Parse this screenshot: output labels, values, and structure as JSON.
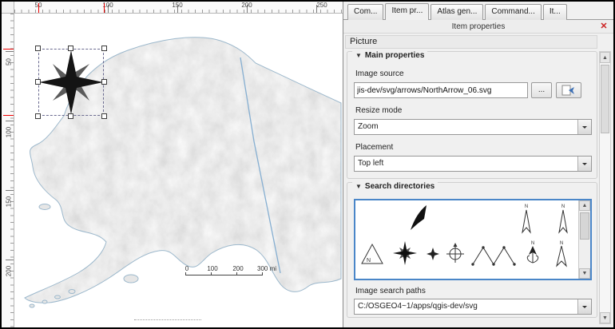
{
  "rulers": {
    "top": [
      "50",
      "100",
      "150",
      "200",
      "250"
    ],
    "left": [
      "50",
      "100",
      "150",
      "200"
    ]
  },
  "map": {
    "scalebar_labels": [
      "0",
      "100",
      "200",
      "300 mi"
    ]
  },
  "panel": {
    "tabs": [
      {
        "label": "Com..."
      },
      {
        "label": "Item pr...",
        "active": true
      },
      {
        "label": "Atlas gen..."
      },
      {
        "label": "Command..."
      },
      {
        "label": "It..."
      }
    ],
    "header": {
      "title": "Item properties",
      "close": "✕"
    },
    "section_title": "Picture",
    "collapse_glyph": "▼",
    "scroll_up": "▲",
    "scroll_down": "▼",
    "main_properties": {
      "title": "Main properties",
      "image_source_label": "Image source",
      "image_source_value": "jis-dev/svg/arrows/NorthArrow_06.svg",
      "browse_button": "...",
      "resize_mode_label": "Resize mode",
      "resize_mode_value": "Zoom",
      "placement_label": "Placement",
      "placement_value": "Top left"
    },
    "search_directories": {
      "title": "Search directories",
      "letter_n": "N",
      "preview_icons": [
        "north-arrow-swoosh",
        "north-arrow-outline-tall",
        "north-arrow-outline-tall-2",
        "triangle-north",
        "compass-star-8",
        "star-4",
        "circle-crosshair",
        "zigzag-w",
        "fleur-north",
        "arrow-outline-north"
      ]
    },
    "image_search_paths": {
      "label": "Image search paths",
      "value": "C:/OSGEO4~1/apps/qgis-dev/svg"
    }
  },
  "colors": {
    "selection_border": "#4a86c8",
    "close_red": "#cc2222"
  }
}
